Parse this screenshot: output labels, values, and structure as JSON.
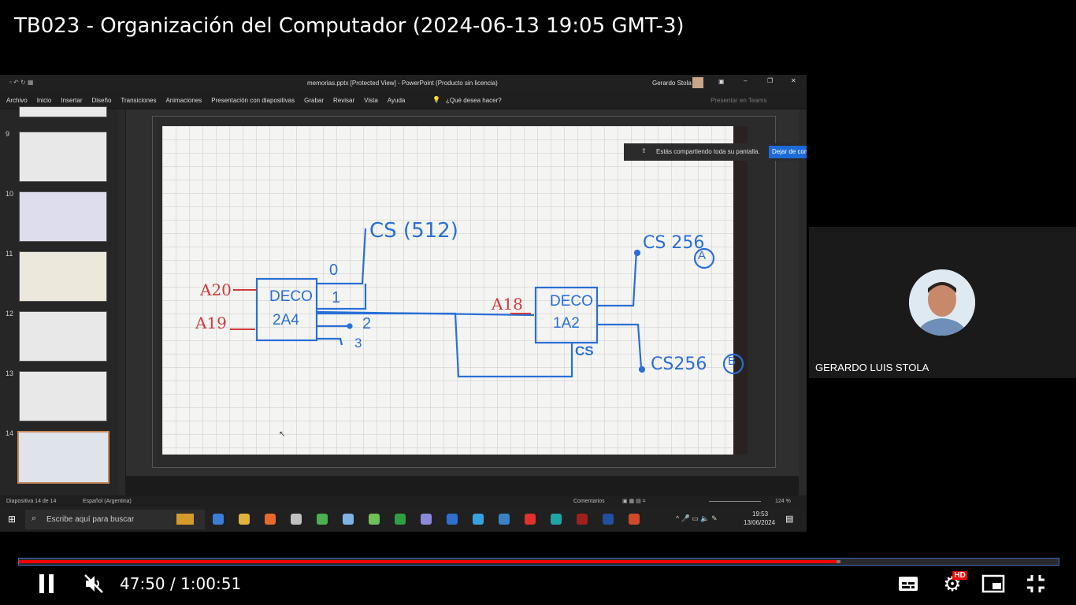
{
  "video": {
    "title": "TB023 - Organización del Computador (2024-06-13 19:05 GMT-3)",
    "current_time": "47:50",
    "separator": " / ",
    "duration": "1:00:51",
    "progress_fraction": 0.786,
    "buffered_fraction": 0.79
  },
  "powerpoint": {
    "window_title": "memorias.pptx [Protected View]  -  PowerPoint (Producto sin licencia)",
    "user": "Gerardo Stola",
    "ribbon_tabs": [
      "Archivo",
      "Inicio",
      "Insertar",
      "Diseño",
      "Transiciones",
      "Animaciones",
      "Presentación con diapositivas",
      "Grabar",
      "Revisar",
      "Vista",
      "Ayuda"
    ],
    "tell_me": "¿Qué desea hacer?",
    "present_teams": "Presentar en Teams",
    "thumbnail_numbers": [
      "9",
      "10",
      "11",
      "12",
      "13",
      "14"
    ],
    "status_slide": "Diapositiva 14 de 14",
    "status_language": "Español (Argentina)",
    "status_comments": "Comentarios",
    "zoom": "124 %"
  },
  "share_banner": {
    "text": "Estás compartiendo toda su pantalla.",
    "button": "Dejar de compartir"
  },
  "taskbar": {
    "search_placeholder": "Escribe aquí para buscar",
    "clock_time": "19:53",
    "clock_date": "13/06/2024"
  },
  "diagram": {
    "cs512": "CS (512)",
    "cs256a": "CS 256",
    "a_label": "A",
    "cs256b": "CS256",
    "b_label": "B",
    "a20": "A20",
    "a19": "A19",
    "a18": "A18",
    "deco1_line1": "DECO",
    "deco1_line2": "2A4",
    "deco2_line1": "DECO",
    "deco2_line2": "1A2",
    "out0": "0",
    "out1": "1",
    "out2": "2",
    "out3": "3",
    "cs_label": "CS"
  },
  "participant": {
    "name": "GERARDO LUIS STOLA"
  },
  "colors": {
    "progress": "#ff0000",
    "pen_blue": "#2a6fd6",
    "pen_red": "#d03a3a",
    "share_button": "#1c6bd8"
  },
  "icons": [
    "pause-icon",
    "volume-muted-icon",
    "subtitles-icon",
    "settings-icon",
    "miniplayer-icon",
    "exit-fullscreen-icon",
    "windows-start-icon",
    "search-icon"
  ]
}
